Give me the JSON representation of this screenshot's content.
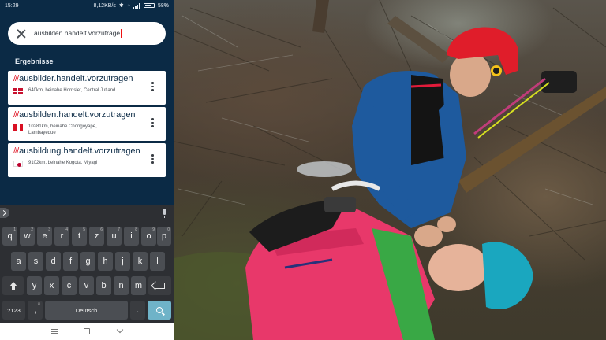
{
  "status_bar": {
    "time": "15:29",
    "network_speed": "8,12KB/s",
    "battery": "58%"
  },
  "search": {
    "value": "ausbilden.handelt.vorzutrage"
  },
  "results": {
    "heading": "Ergebnisse",
    "items": [
      {
        "prefix": "///",
        "address": "ausbilder.handelt.vorzutragen",
        "flag": "denmark-flag-icon",
        "detail": "640km, beinahe Hornslet, Central Jutland"
      },
      {
        "prefix": "///",
        "address": "ausbilden.handelt.vorzutragen",
        "flag": "peru-flag-icon",
        "detail": "10281km, beinahe Chongoyape, Lambayeque"
      },
      {
        "prefix": "///",
        "address": "ausbildung.handelt.vorzutragen",
        "flag": "japan-flag-icon",
        "detail": "9102km, beinahe Kogota, Miyagi"
      }
    ]
  },
  "keyboard": {
    "row1": [
      "q",
      "w",
      "e",
      "r",
      "t",
      "z",
      "u",
      "i",
      "o",
      "p"
    ],
    "row1_alt": [
      "1",
      "2",
      "3",
      "4",
      "5",
      "6",
      "7",
      "8",
      "9",
      "0"
    ],
    "row2": [
      "a",
      "s",
      "d",
      "f",
      "g",
      "h",
      "j",
      "k",
      "l"
    ],
    "row3": [
      "y",
      "x",
      "c",
      "v",
      "b",
      "n",
      "m"
    ],
    "symbols_label": "?123",
    "comma": ",",
    "space_label": "Deutsch",
    "period": "."
  },
  "colors": {
    "app_background": "#0b2a45",
    "w3w_red": "#e11d2b",
    "enter_key": "#6fb3c8"
  },
  "photo": {
    "icon": "mountain-rescue-photo"
  }
}
